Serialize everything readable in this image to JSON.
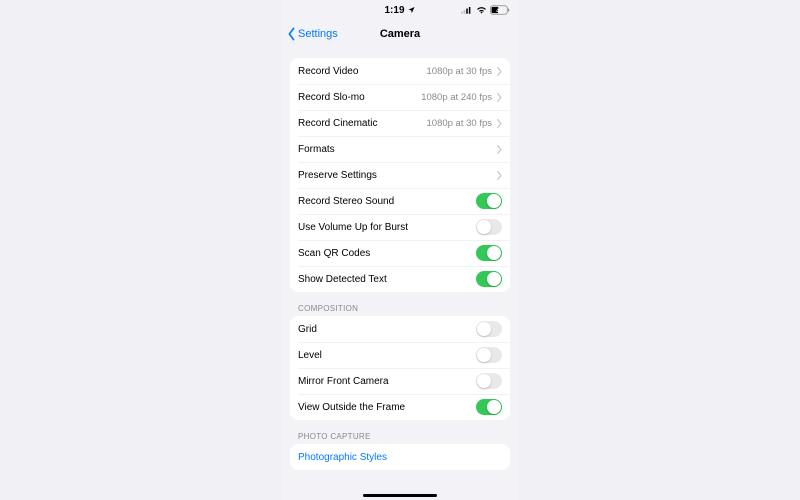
{
  "statusbar": {
    "time": "1:19",
    "battery": "44"
  },
  "nav": {
    "back_label": "Settings",
    "title": "Camera"
  },
  "group1": {
    "record_video": {
      "label": "Record Video",
      "detail": "1080p at 30 fps"
    },
    "record_slomo": {
      "label": "Record Slo-mo",
      "detail": "1080p at 240 fps"
    },
    "record_cinematic": {
      "label": "Record Cinematic",
      "detail": "1080p at 30 fps"
    },
    "formats": {
      "label": "Formats"
    },
    "preserve": {
      "label": "Preserve Settings"
    },
    "stereo": {
      "label": "Record Stereo Sound",
      "on": true
    },
    "volburst": {
      "label": "Use Volume Up for Burst",
      "on": false
    },
    "qr": {
      "label": "Scan QR Codes",
      "on": true
    },
    "detected_text": {
      "label": "Show Detected Text",
      "on": true
    }
  },
  "composition_header": "COMPOSITION",
  "group2": {
    "grid": {
      "label": "Grid",
      "on": false
    },
    "level": {
      "label": "Level",
      "on": false
    },
    "mirror": {
      "label": "Mirror Front Camera",
      "on": false
    },
    "outside": {
      "label": "View Outside the Frame",
      "on": true
    }
  },
  "photo_header": "PHOTO CAPTURE",
  "group3": {
    "styles": {
      "label": "Photographic Styles"
    }
  }
}
